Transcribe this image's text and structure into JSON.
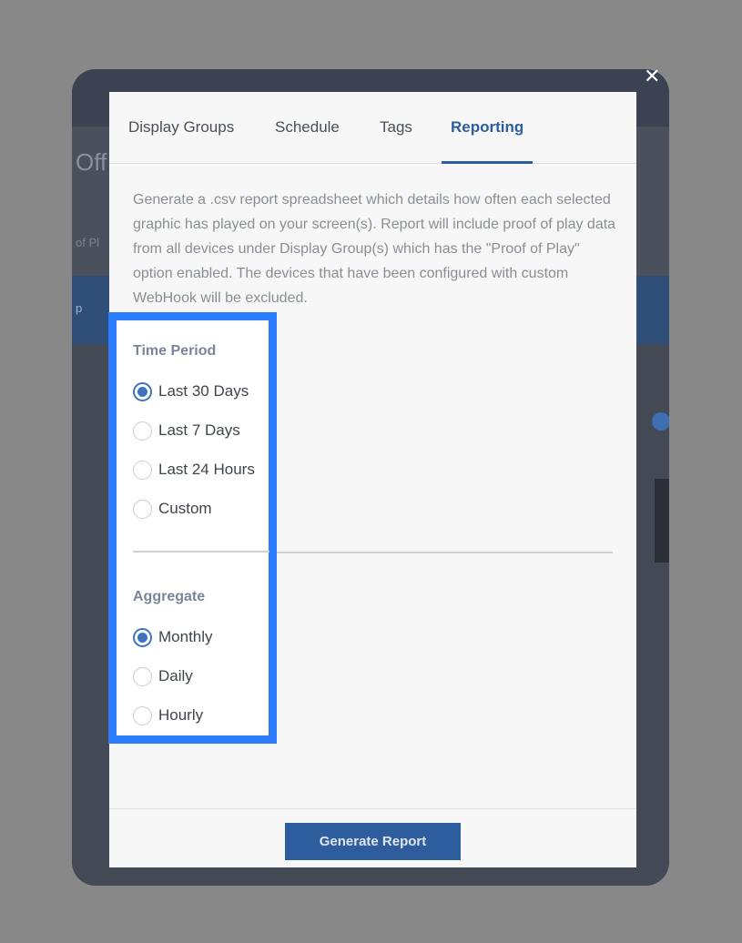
{
  "window": {
    "close_icon": "close-icon"
  },
  "background_app": {
    "partial_heading": "Off",
    "partial_field": "of Pl",
    "partial_bar_text": "p"
  },
  "tabs": [
    {
      "label": "Display Groups",
      "active": false
    },
    {
      "label": "Schedule",
      "active": false
    },
    {
      "label": "Tags",
      "active": false
    },
    {
      "label": "Reporting",
      "active": true
    }
  ],
  "description": "Generate a .csv report spreadsheet which details how often each selected graphic has played on your screen(s). Report will include proof of play data from all devices under Display Group(s) which has the \"Proof of Play\" option enabled. The devices that have been configured with custom WebHook will be excluded.",
  "time_period": {
    "label": "Time Period",
    "options": [
      {
        "label": "Last 30 Days",
        "checked": true
      },
      {
        "label": "Last 7 Days",
        "checked": false
      },
      {
        "label": "Last 24 Hours",
        "checked": false
      },
      {
        "label": "Custom",
        "checked": false
      }
    ]
  },
  "aggregate": {
    "label": "Aggregate",
    "options": [
      {
        "label": "Monthly",
        "checked": true
      },
      {
        "label": "Daily",
        "checked": false
      },
      {
        "label": "Hourly",
        "checked": false
      }
    ]
  },
  "footer": {
    "generate_label": "Generate Report"
  },
  "colors": {
    "accent": "#2e5d9e",
    "highlight": "#2b7bff",
    "overlay": "#888888"
  }
}
